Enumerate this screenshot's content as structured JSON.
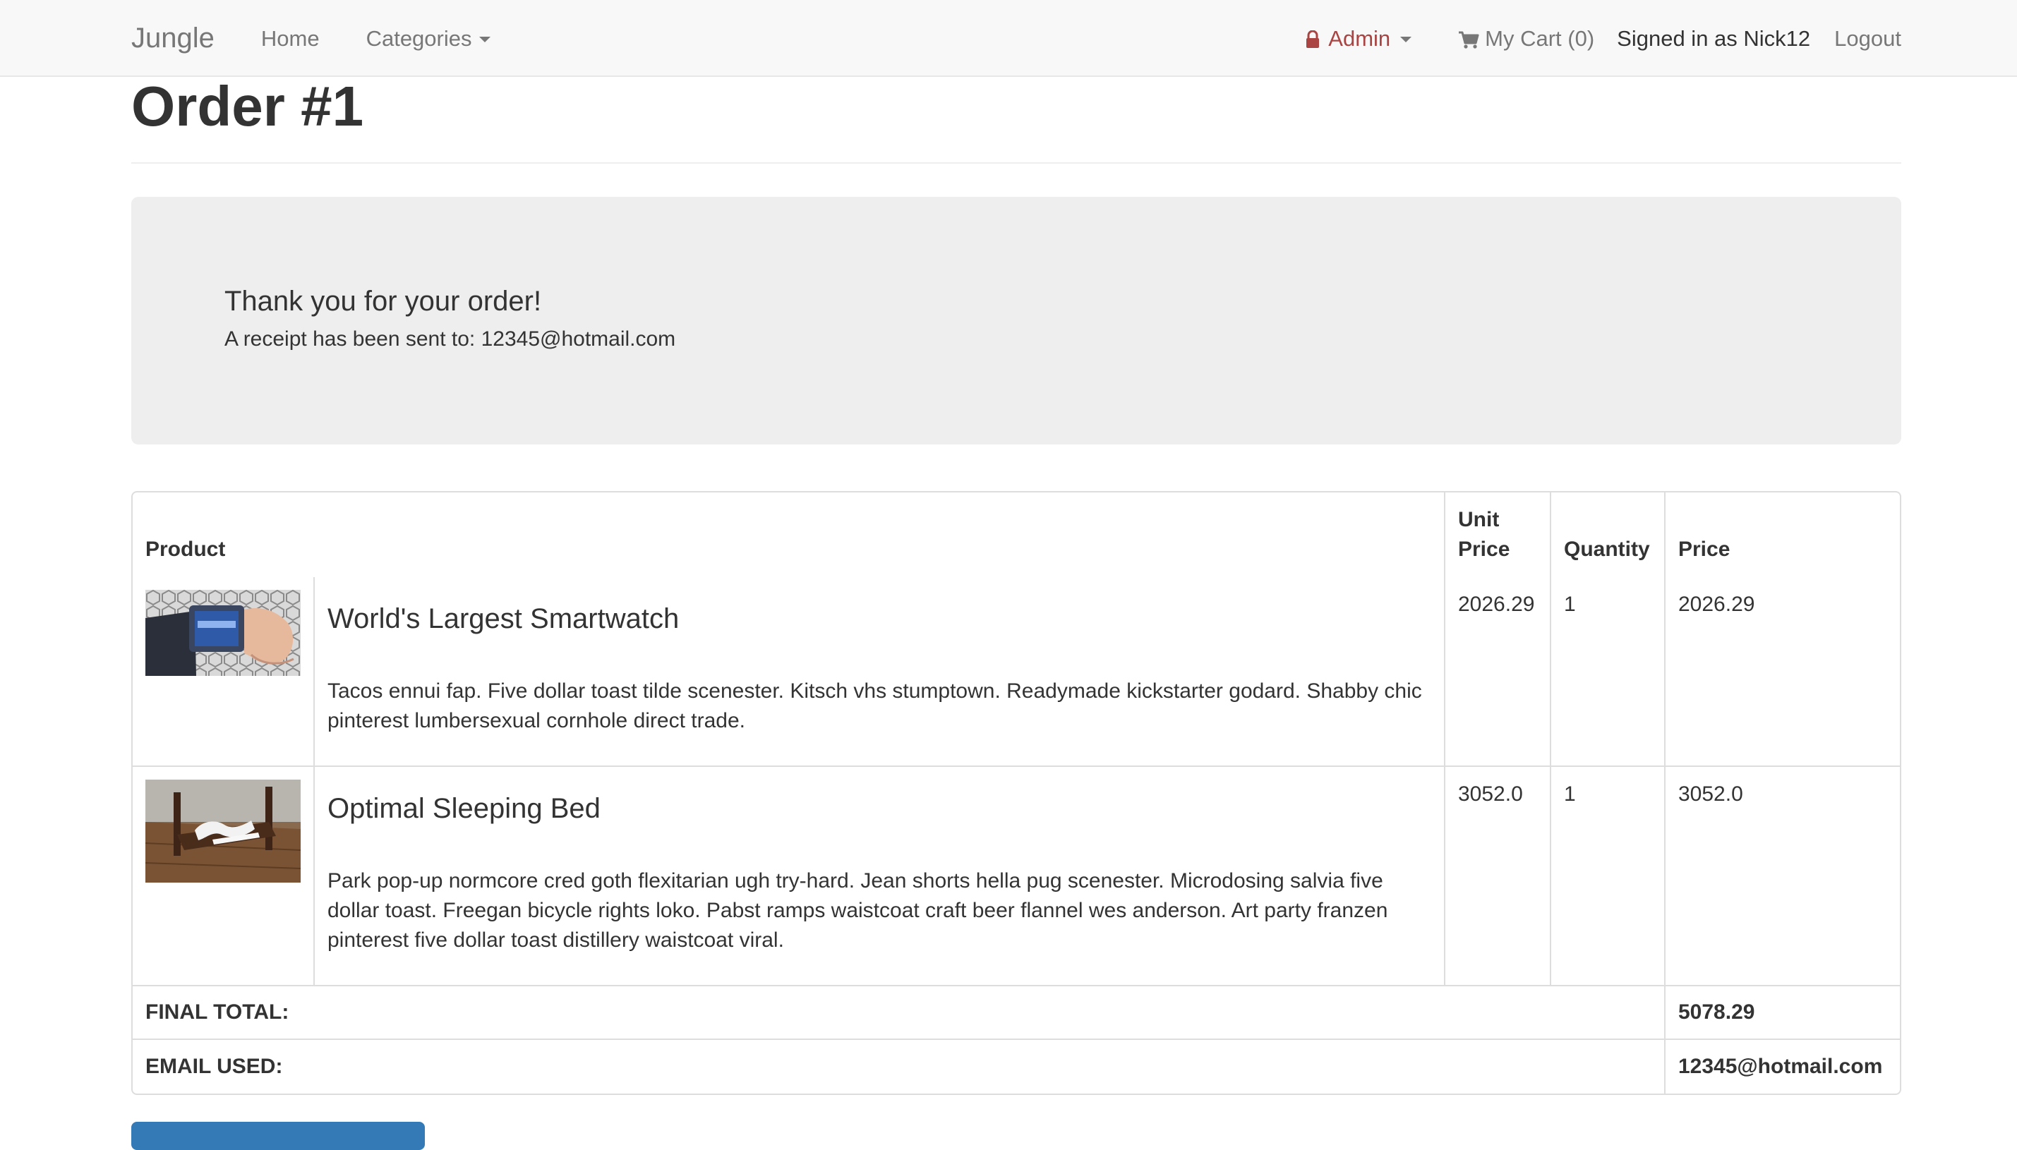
{
  "navbar": {
    "brand": "Jungle",
    "home": "Home",
    "categories": "Categories",
    "admin": "Admin",
    "cart": "My Cart (0)",
    "signed_in": "Signed in as Nick12",
    "logout": "Logout"
  },
  "page": {
    "title": "Order #1"
  },
  "jumbotron": {
    "heading": "Thank you for your order!",
    "receipt": "A receipt has been sent to: 12345@hotmail.com"
  },
  "table": {
    "headers": {
      "product": "Product",
      "unit_price": "Unit Price",
      "quantity": "Quantity",
      "price": "Price"
    },
    "rows": [
      {
        "name": "World's Largest Smartwatch",
        "description": "Tacos ennui fap. Five dollar toast tilde scenester. Kitsch vhs stumptown. Readymade kickstarter godard. Shabby chic pinterest lumbersexual cornhole direct trade.",
        "unit_price": "2026.29",
        "quantity": "1",
        "price": "2026.29"
      },
      {
        "name": "Optimal Sleeping Bed",
        "description": "Park pop-up normcore cred goth flexitarian ugh try-hard. Jean shorts hella pug scenester. Microdosing salvia five dollar toast. Freegan bicycle rights loko. Pabst ramps waistcoat craft beer flannel wes anderson. Art party franzen pinterest five dollar toast distillery waistcoat viral.",
        "unit_price": "3052.0",
        "quantity": "1",
        "price": "3052.0"
      }
    ],
    "final_total_label": "FINAL TOTAL:",
    "final_total_value": "5078.29",
    "email_label": "EMAIL USED:",
    "email_value": "12345@hotmail.com"
  },
  "colors": {
    "admin": "#a94442",
    "navbar_bg": "#f8f8f8",
    "jumbotron_bg": "#eeeeee",
    "primary_button": "#337ab7"
  }
}
